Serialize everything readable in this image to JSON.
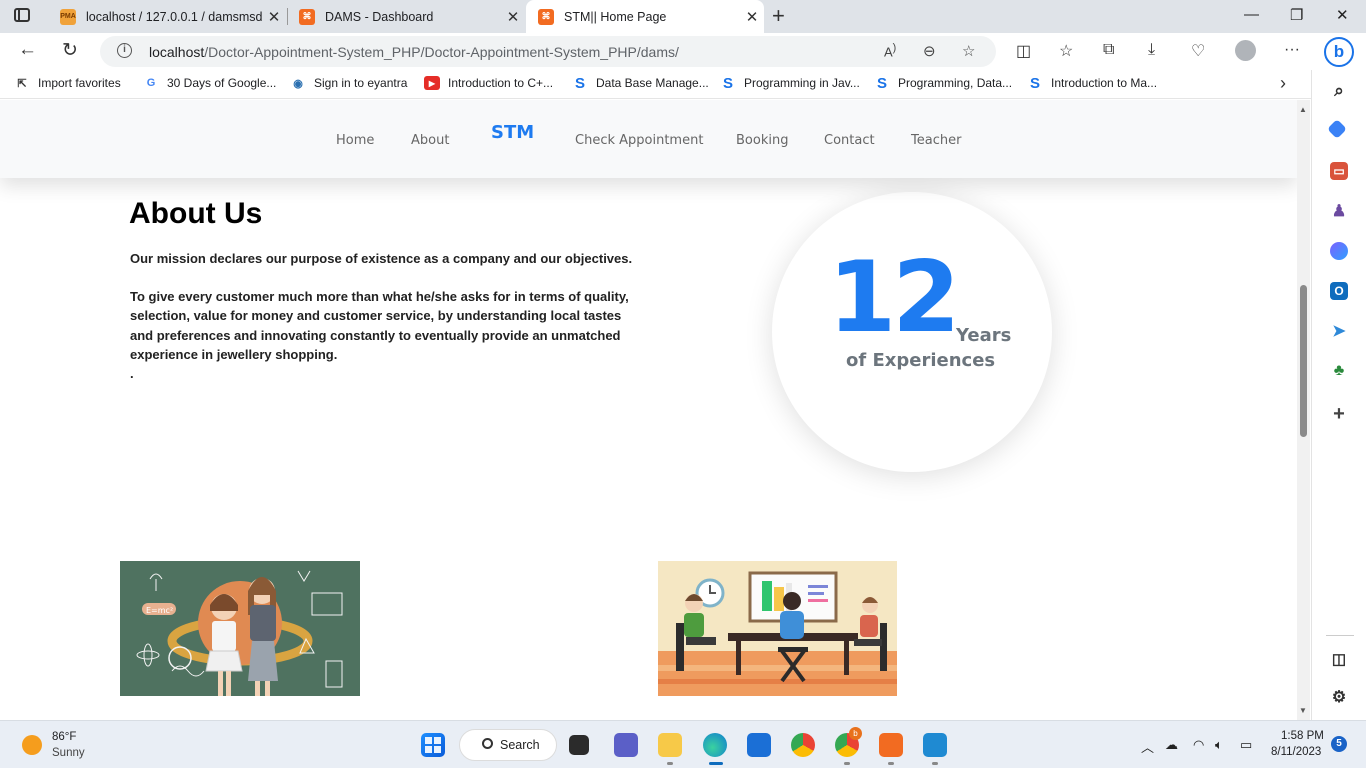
{
  "browser": {
    "tabs": [
      {
        "title": "localhost / 127.0.0.1 / damsmsdb",
        "favicon": "PMA",
        "active": false
      },
      {
        "title": "DAMS - Dashboard",
        "favicon": "xampp-icon",
        "active": false
      },
      {
        "title": "STM|| Home Page",
        "favicon": "xampp-icon",
        "active": true
      }
    ],
    "address": {
      "host": "localhost",
      "path": "/Doctor-Appointment-System_PHP/Doctor-Appointment-System_PHP/dams/"
    },
    "favorites": [
      {
        "label": "Import favorites",
        "icon": "import-icon"
      },
      {
        "label": "30 Days of Google...",
        "icon": "google-icon"
      },
      {
        "label": "Sign in to eyantra",
        "icon": "eyantra-icon"
      },
      {
        "label": "Introduction to C+...",
        "icon": "youtube-icon"
      },
      {
        "label": "Data Base Manage...",
        "icon": "s-icon"
      },
      {
        "label": "Programming in Jav...",
        "icon": "s-icon"
      },
      {
        "label": "Programming, Data...",
        "icon": "s-icon"
      },
      {
        "label": "Introduction to Ma...",
        "icon": "s-icon"
      }
    ]
  },
  "site": {
    "nav": {
      "home": "Home",
      "about": "About",
      "brand": "STM",
      "check": "Check Appointment",
      "booking": "Booking",
      "contact": "Contact",
      "teacher": "Teacher"
    },
    "about": {
      "title": "About Us",
      "mission": "Our mission declares our purpose of existence as a company and our objectives.",
      "body": "To give every customer much more than what he/she asks for in terms of quality, selection, value for money and customer service, by understanding local tastes and preferences and innovating constantly to eventually provide an unmatched experience in jewellery shopping.",
      "trailing": "."
    },
    "experience": {
      "number": "12",
      "unit": "Years",
      "label": "of Experiences"
    }
  },
  "taskbar": {
    "weather": {
      "temp": "86°F",
      "desc": "Sunny"
    },
    "search_label": "Search",
    "time": "1:58 PM",
    "date": "8/11/2023",
    "notifications": "5",
    "browser_badge": "b"
  },
  "colors": {
    "brand_blue": "#1e7bf0",
    "muted_gray": "#6c757d",
    "nav_bg": "#f8f9fa"
  }
}
